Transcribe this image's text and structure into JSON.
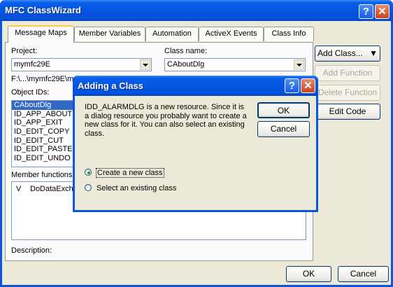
{
  "window": {
    "title": "MFC ClassWizard",
    "help_glyph": "?",
    "close_glyph": "✕"
  },
  "tabs": [
    {
      "label": "Message Maps",
      "active": true
    },
    {
      "label": "Member Variables",
      "active": false
    },
    {
      "label": "Automation",
      "active": false
    },
    {
      "label": "ActiveX Events",
      "active": false
    },
    {
      "label": "Class Info",
      "active": false
    }
  ],
  "project": {
    "label": "Project:",
    "value": "mymfc29E"
  },
  "class_name": {
    "label": "Class name:",
    "value": "CAboutDlg"
  },
  "path": "F:\\...\\mymfc29E\\m",
  "object_ids": {
    "label": "Object IDs:",
    "items": [
      "CAboutDlg",
      "ID_APP_ABOUT",
      "ID_APP_EXIT",
      "ID_EDIT_COPY",
      "ID_EDIT_CUT",
      "ID_EDIT_PASTE",
      "ID_EDIT_UNDO"
    ],
    "selected": 0
  },
  "member_functions": {
    "label": "Member functions:",
    "items": [
      {
        "marker": "V",
        "name": "DoDataExch"
      }
    ]
  },
  "description_label": "Description:",
  "side_buttons": {
    "add_class": "Add Class...",
    "add_function": "Add Function",
    "delete_function": "Delete Function",
    "edit_code": "Edit Code"
  },
  "footer": {
    "ok": "OK",
    "cancel": "Cancel"
  },
  "dialog": {
    "title": "Adding a Class",
    "message": "IDD_ALARMDLG is a new resource.  Since it is a dialog resource you probably want to create a new class for it.  You can also select an existing class.",
    "ok": "OK",
    "cancel": "Cancel",
    "options": [
      {
        "label": "Create a new class",
        "checked": true
      },
      {
        "label": "Select an existing class",
        "checked": false
      }
    ]
  }
}
